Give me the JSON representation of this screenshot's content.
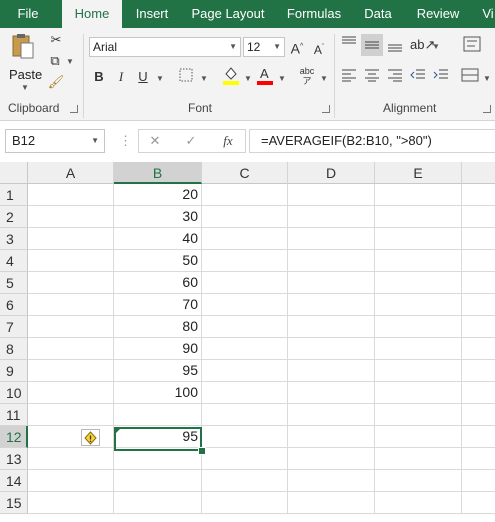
{
  "tabs": [
    "File",
    "Home",
    "Insert",
    "Page Layout",
    "Formulas",
    "Data",
    "Review",
    "Vi"
  ],
  "active_tab": "Home",
  "clipboard": {
    "paste_label": "Paste",
    "group_label": "Clipboard"
  },
  "font": {
    "name": "Arial",
    "size": "12",
    "group_label": "Font"
  },
  "alignment": {
    "group_label": "Alignment"
  },
  "formula_bar": {
    "name_box": "B12",
    "formula": "=AVERAGEIF(B2:B10, \">80\")",
    "fx_label": "fx"
  },
  "columns": [
    "A",
    "B",
    "C",
    "D",
    "E"
  ],
  "rows": [
    "1",
    "2",
    "3",
    "4",
    "5",
    "6",
    "7",
    "8",
    "9",
    "10",
    "11",
    "12",
    "13",
    "14",
    "15"
  ],
  "column_b": [
    "20",
    "30",
    "40",
    "50",
    "60",
    "70",
    "80",
    "90",
    "95",
    "100",
    "",
    "95",
    "",
    "",
    ""
  ],
  "selected_cell": "B12",
  "colors": {
    "accent": "#217346",
    "highlight_yellow": "#ffff00",
    "font_red": "#ff0000"
  }
}
